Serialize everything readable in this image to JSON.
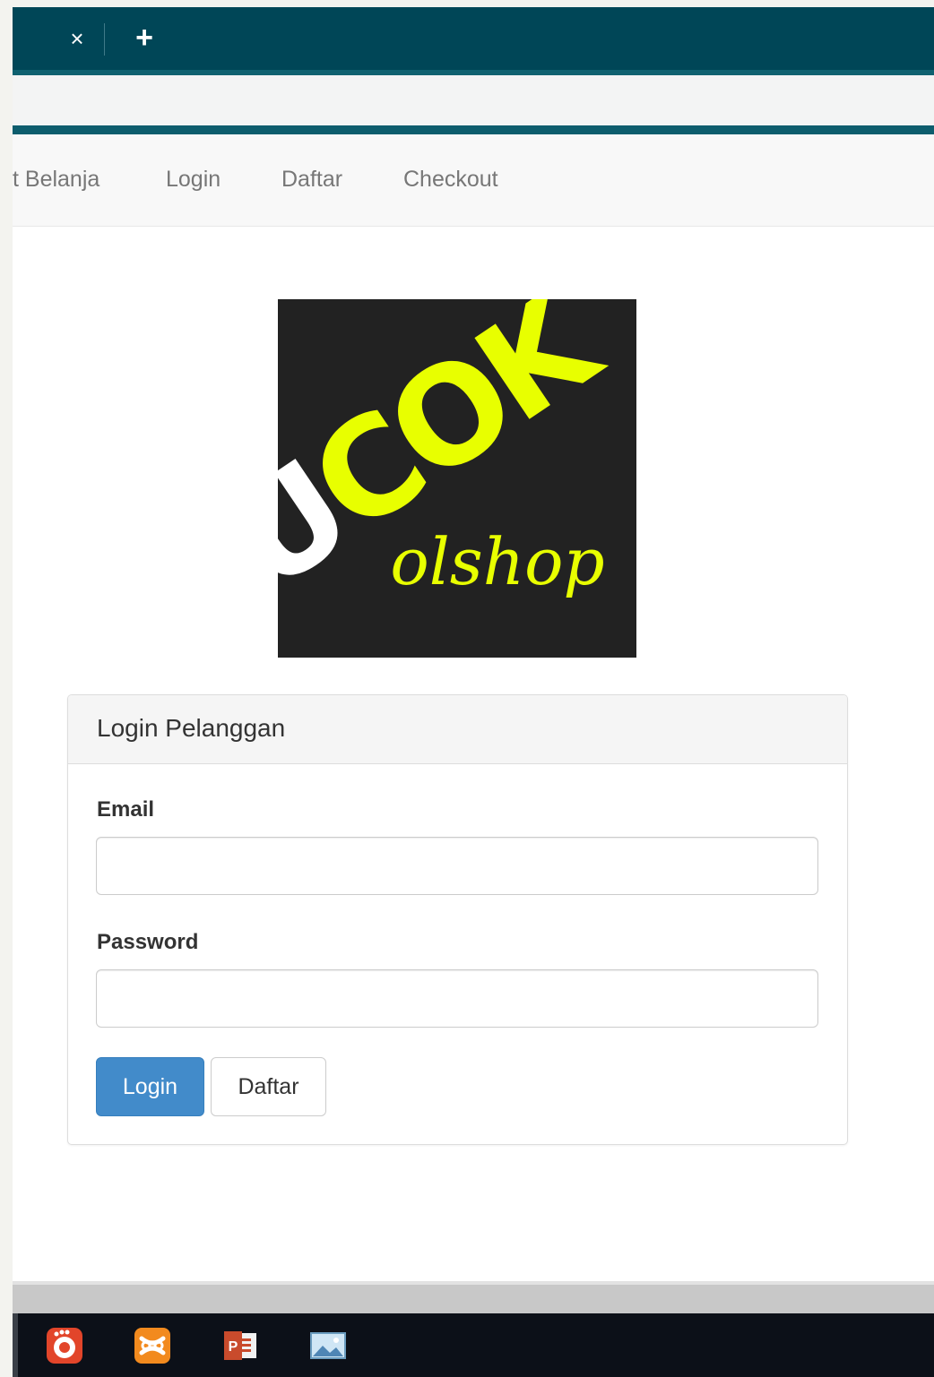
{
  "browser": {
    "close_tab_glyph": "×",
    "new_tab_glyph": "+"
  },
  "navbar": {
    "links": [
      "t Belanja",
      "Login",
      "Daftar",
      "Checkout"
    ]
  },
  "logo": {
    "brand": "UCOK",
    "tagline": "olshop",
    "colors": {
      "background": "#222222",
      "accent": "#e8ff00",
      "letter_u": "#ffffff"
    }
  },
  "login_panel": {
    "title": "Login Pelanggan",
    "email_label": "Email",
    "email_value": "",
    "password_label": "Password",
    "password_value": "",
    "login_button": "Login",
    "register_button": "Daftar"
  },
  "taskbar": {
    "icons": [
      "snagit-icon",
      "xampp-icon",
      "powerpoint-icon",
      "photo-viewer-icon"
    ]
  },
  "colors": {
    "tabbar": "#004657",
    "primary_button": "#428bca"
  }
}
